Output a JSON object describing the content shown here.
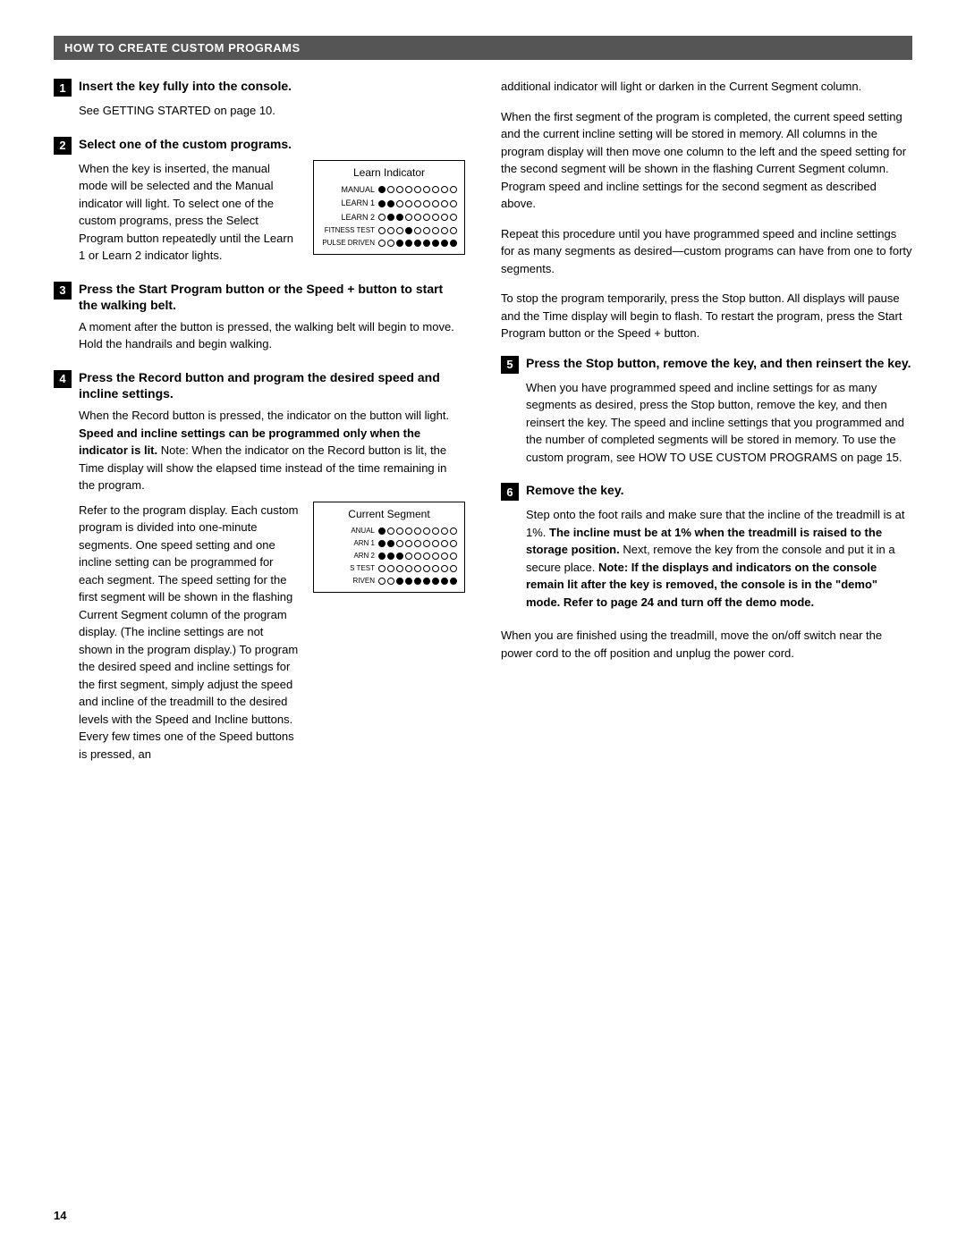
{
  "header": {
    "title": "HOW TO CREATE CUSTOM PROGRAMS"
  },
  "page_number": "14",
  "steps": [
    {
      "num": "1",
      "title": "Insert the key fully into the console.",
      "body_lines": [
        "See GETTING STARTED on page 10."
      ]
    },
    {
      "num": "2",
      "title": "Select one of the custom programs.",
      "inline_text": "When the key is inserted, the manual mode will be selected and the Manual indicator will light. To select one of the custom programs, press the Select Program button repeatedly until the Learn 1 or Learn 2 indicator lights.",
      "indicator_title": "Learn Indicator",
      "indicator_rows": [
        {
          "label": "MANUAL",
          "dots": [
            1,
            0,
            0,
            0,
            0,
            0,
            0,
            0,
            0
          ]
        },
        {
          "label": "LEARN 1",
          "dots": [
            1,
            1,
            0,
            0,
            0,
            0,
            0,
            0,
            0
          ]
        },
        {
          "label": "LEARN 2",
          "dots": [
            0,
            1,
            1,
            0,
            0,
            0,
            0,
            0,
            0
          ]
        },
        {
          "label": "FITNESS TEST",
          "dots": [
            0,
            0,
            0,
            1,
            0,
            0,
            0,
            0,
            0
          ]
        },
        {
          "label": "PULSE DRIVEN",
          "dots": [
            0,
            0,
            1,
            1,
            1,
            1,
            1,
            1,
            1
          ]
        }
      ]
    },
    {
      "num": "3",
      "title": "Press the Start Program button or the Speed + button to start the walking belt.",
      "body_lines": [
        "A moment after the button is pressed, the walking belt will begin to move. Hold the handrails and begin walking."
      ]
    },
    {
      "num": "4",
      "title": "Press the Record button and program the desired speed and incline settings.",
      "body_paras": [
        "When the Record button is pressed, the indicator on the button will light. Speed and incline settings can be programmed only when the indicator is lit. Note: When the indicator on the Record button is lit, the Time display will show the elapsed time instead of the time remaining in the program.",
        "Refer to the program display. Each custom program is divided into one-minute segments. One speed setting and one incline setting can be programmed for each segment. The speed setting for the first segment will be shown in the flashing Current Segment column of the program display. (The incline settings are not shown in the program display.) To program the desired speed and incline settings for the first segment, simply adjust the speed and incline of the treadmill to the desired levels with the Speed and Incline buttons. Every few times one of the Speed buttons is pressed, an"
      ],
      "segment_title": "Current Segment",
      "segment_rows": [
        {
          "label": "ANUAL",
          "dots": [
            1,
            0,
            0,
            0,
            0,
            0,
            0,
            0,
            0
          ]
        },
        {
          "label": "ARN 1",
          "dots": [
            1,
            1,
            0,
            0,
            0,
            0,
            0,
            0,
            0
          ]
        },
        {
          "label": "ARN 2",
          "dots": [
            1,
            1,
            1,
            0,
            0,
            0,
            0,
            0,
            0
          ]
        },
        {
          "label": "S TEST",
          "dots": [
            0,
            0,
            0,
            0,
            0,
            0,
            0,
            0,
            0
          ]
        },
        {
          "label": "RIVEN",
          "dots": [
            0,
            0,
            1,
            1,
            1,
            1,
            1,
            1,
            1
          ]
        }
      ]
    },
    {
      "num": "5",
      "title": "Press the Stop button, remove the key, and then reinsert the key.",
      "body_lines": [
        "When you have programmed speed and incline settings for as many segments as desired, press the Stop button, remove the key, and then reinsert the key. The speed and incline settings that you programmed and the number of completed segments will be stored in memory. To use the custom program, see HOW TO USE CUSTOM PROGRAMS on page 15."
      ]
    },
    {
      "num": "6",
      "title": "Remove the key.",
      "body_paras": [
        "Step onto the foot rails and make sure that the incline of the treadmill is at 1%. The incline must be at 1% when the treadmill is raised to the storage position. Next, remove the key from the console and put it in a secure place. Note: If the displays and indicators on the console remain lit after the key is removed, the console is in the “demo” mode. Refer to page 24 and turn off the demo mode."
      ]
    }
  ],
  "right_col_paras": [
    "additional indicator will light or darken in the Current Segment column.",
    "When the first segment of the program is completed, the current speed setting and the current incline setting will be stored in memory. All columns in the program display will then move one column to the left and the speed setting for the second segment will be shown in the flashing Current Segment column. Program speed and incline settings for the second segment as described above.",
    "Repeat this procedure until you have programmed speed and incline settings for as many segments as desired—custom programs can have from one to forty segments.",
    "To stop the program temporarily, press the Stop button. All displays will pause and the Time display will begin to flash. To restart the program, press the Start Program button or the Speed + button.",
    "When you are finished using the treadmill, move the on/off switch near the power cord to the off position and unplug the power cord."
  ]
}
